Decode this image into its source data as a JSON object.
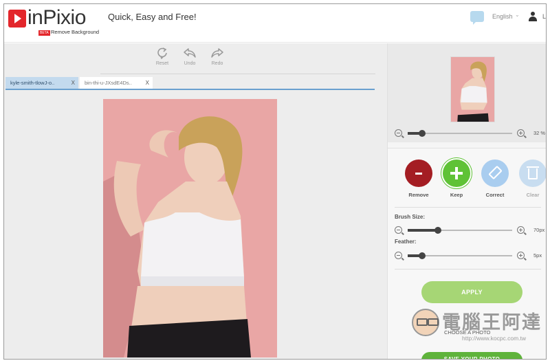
{
  "header": {
    "brand": "inPixio",
    "badge": "BETA",
    "subtitle": "Remove Background",
    "tagline": "Quick, Easy and Free!",
    "language": "English",
    "user_initial": "L"
  },
  "toolbar": {
    "reset": "Reset",
    "undo": "Undo",
    "redo": "Redo"
  },
  "tabs": [
    {
      "label": "kyle-smith-tlowJ-o..",
      "close": "X",
      "active": true
    },
    {
      "label": "bin-thi-u-JXsdE4Ds..",
      "close": "X",
      "active": false
    }
  ],
  "preview": {
    "zoom": "32 %",
    "zoom_level": 0.14
  },
  "tools": {
    "remove": "Remove",
    "keep": "Keep",
    "correct": "Correct",
    "clear": "Clear"
  },
  "brush": {
    "label": "Brush Size:",
    "value": "70px",
    "level": 0.29
  },
  "feather": {
    "label": "Feather:",
    "value": "5px",
    "level": 0.14
  },
  "actions": {
    "apply": "APPLY",
    "choose": "CHOOSE A PHOTO",
    "save": "SAVE YOUR PHOTO"
  },
  "watermark": {
    "text": "電腦王阿達",
    "url": "http://www.kocpc.com.tw"
  },
  "colors": {
    "brand_red": "#e3262b",
    "remove": "#a41d23",
    "keep": "#5fc236",
    "correct": "#a9cdef",
    "apply": "#a6d675",
    "save": "#5fb33b",
    "tab_active": "#c3daee"
  }
}
